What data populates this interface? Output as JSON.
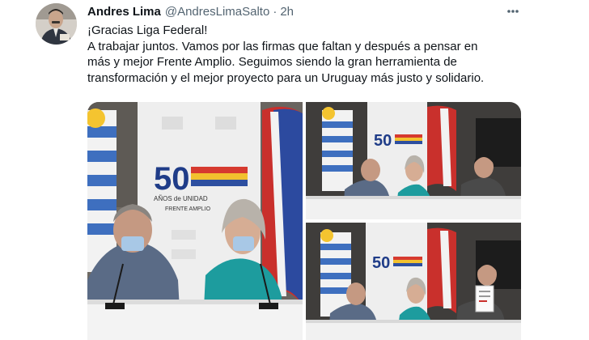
{
  "author": {
    "display_name": "Andres Lima",
    "handle": "@AndresLimaSalto",
    "separator": "·",
    "time": "2h"
  },
  "tweet": {
    "lines": [
      "¡Gracias Liga Federal!",
      "A trabajar juntos. Vamos por las firmas que faltan y después a pensar en",
      "más y mejor Frente Amplio. Seguimos siendo la gran herramienta de",
      "transformación y el mejor proyecto para un Uruguay más justo y solidario."
    ]
  },
  "media": {
    "banner_number": "50",
    "banner_line1": "AÑOS de UNIDAD",
    "banner_line2": "FRENTE AMPLIO"
  },
  "icons": {
    "more": "more-horizontal-icon",
    "avatar": "avatar"
  }
}
